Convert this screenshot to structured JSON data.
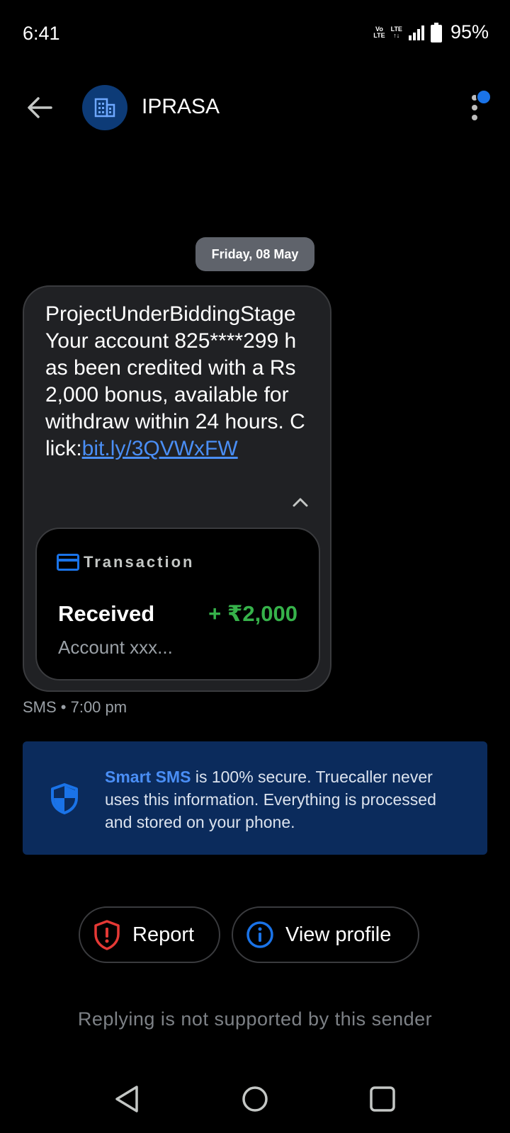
{
  "status_bar": {
    "time": "6:41",
    "network_top": "Vo",
    "network_bottom": "LTE",
    "lte_top": "LTE",
    "lte_bottom": "↑↓",
    "battery": "95%"
  },
  "header": {
    "sender": "IPRASA",
    "avatar_icon": "building-icon",
    "back_icon": "arrow-left-icon",
    "menu_icon": "more-vert-icon",
    "has_notification": true
  },
  "conversation": {
    "date_chip": "Friday, 08 May",
    "message": {
      "text": "ProjectUnderBiddingStage Your account 825****299 has been credited with a Rs 2,000 bonus, available for withdraw within 24 hours. Click:",
      "link": "bit.ly/3QVWxFW",
      "meta": "SMS • 7:00 pm"
    },
    "transaction": {
      "title": "Transaction",
      "status": "Received",
      "amount": "+ ₹2,000",
      "account": "Account xxx..."
    }
  },
  "info_banner": {
    "strong": "Smart SMS",
    "text": " is 100% secure. Truecaller never uses this information. Everything is processed and stored on your phone."
  },
  "actions": {
    "report": "Report",
    "view_profile": "View profile"
  },
  "reply_note": "Replying is not supported by this sender",
  "colors": {
    "accent": "#1a73e8",
    "link": "#4a8ef5",
    "amount": "#36b24a",
    "report": "#e53935",
    "banner": "#0b2b5c"
  }
}
